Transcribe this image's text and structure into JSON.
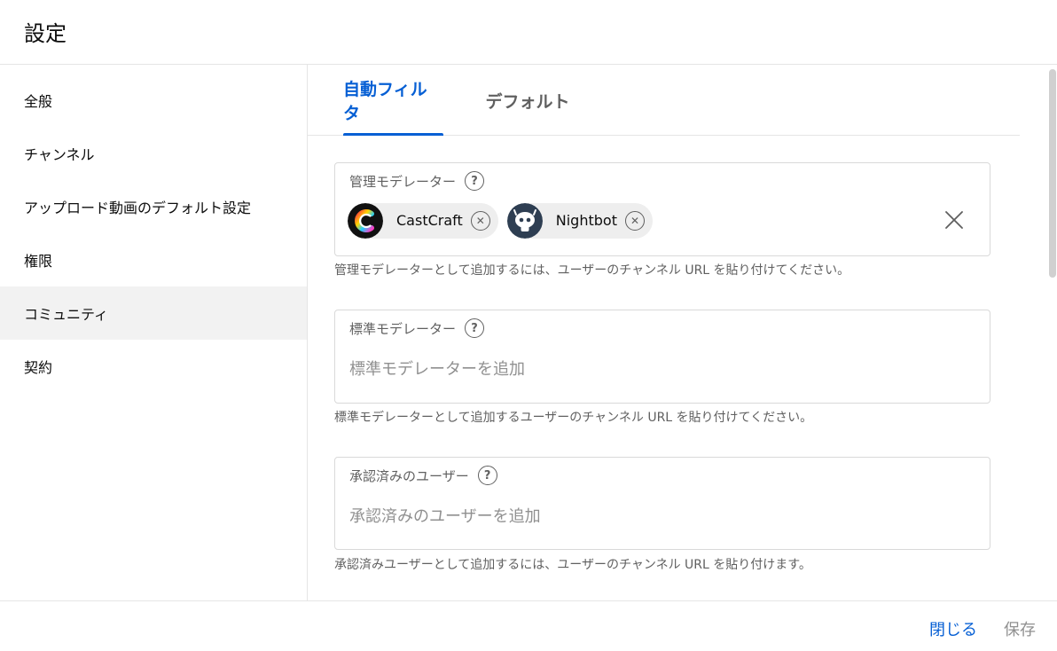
{
  "dialog": {
    "title": "設定"
  },
  "sidebar": {
    "items": [
      {
        "label": "全般"
      },
      {
        "label": "チャンネル"
      },
      {
        "label": "アップロード動画のデフォルト設定"
      },
      {
        "label": "権限"
      },
      {
        "label": "コミュニティ",
        "active": true
      },
      {
        "label": "契約"
      }
    ]
  },
  "tabs": [
    {
      "label": "自動フィルタ",
      "active": true
    },
    {
      "label": "デフォルト"
    }
  ],
  "fields": {
    "managing_moderators": {
      "label": "管理モデレーター",
      "chips": [
        {
          "name": "CastCraft",
          "icon": "castcraft-logo-icon"
        },
        {
          "name": "Nightbot",
          "icon": "nightbot-robot-icon"
        }
      ],
      "helper": "管理モデレーターとして追加するには、ユーザーのチャンネル URL を貼り付けてください。"
    },
    "standard_moderators": {
      "label": "標準モデレーター",
      "placeholder": "標準モデレーターを追加",
      "helper": "標準モデレーターとして追加するユーザーのチャンネル URL を貼り付けてください。"
    },
    "approved_users": {
      "label": "承認済みのユーザー",
      "placeholder": "承認済みのユーザーを追加",
      "helper": "承認済みユーザーとして追加するには、ユーザーのチャンネル URL を貼り付けます。"
    }
  },
  "footer": {
    "close_label": "閉じる",
    "save_label": "保存"
  },
  "colors": {
    "accent": "#065fd4",
    "muted": "#606060",
    "disabled": "#909090",
    "active_bg": "#f2f2f2"
  }
}
